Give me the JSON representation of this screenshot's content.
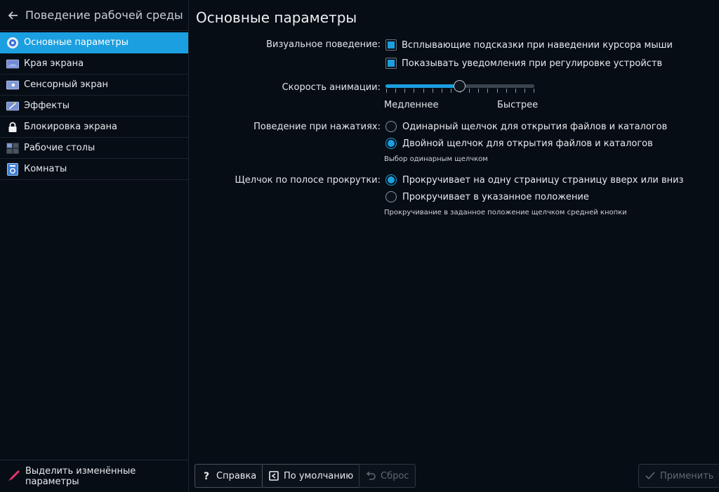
{
  "sidebar": {
    "title": "Поведение рабочей среды",
    "items": [
      {
        "label": "Основные параметры",
        "icon": "general-settings-icon",
        "active": true
      },
      {
        "label": "Края экрана",
        "icon": "screen-edges-icon"
      },
      {
        "label": "Сенсорный экран",
        "icon": "touchscreen-icon"
      },
      {
        "label": "Эффекты",
        "icon": "effects-icon"
      },
      {
        "label": "Блокировка экрана",
        "icon": "lock-icon"
      },
      {
        "label": "Рабочие столы",
        "icon": "virtual-desktops-icon"
      },
      {
        "label": "Комнаты",
        "icon": "activities-icon"
      }
    ],
    "footer_label": "Выделить изменённые параметры"
  },
  "main": {
    "title": "Основные параметры",
    "visual": {
      "label": "Визуальное поведение:",
      "options": [
        {
          "label": "Всплывающие подсказки при наведении курсора мыши",
          "checked": true
        },
        {
          "label": "Показывать уведомления при регулировке устройств",
          "checked": true
        }
      ]
    },
    "animation": {
      "label": "Скорость анимации:",
      "min_label": "Медленнее",
      "max_label": "Быстрее",
      "value": 0.5,
      "ticks": 17
    },
    "click": {
      "label": "Поведение при нажатиях:",
      "options": [
        {
          "label": "Одинарный щелчок для открытия файлов и каталогов",
          "selected": false
        },
        {
          "label": "Двойной щелчок для открытия файлов и каталогов",
          "selected": true
        }
      ],
      "note": "Выбор одинарным щелчком"
    },
    "scrollbar": {
      "label": "Щелчок по полосе прокрутки:",
      "options": [
        {
          "label": "Прокручивает на одну страницу страницу вверх или вниз",
          "selected": true
        },
        {
          "label": "Прокручивает в указанное положение",
          "selected": false
        }
      ],
      "note": "Прокручивание в заданное положение щелчком средней кнопки"
    }
  },
  "buttons": {
    "help": "Справка",
    "defaults": "По умолчанию",
    "reset": "Сброс",
    "apply": "Применить"
  },
  "colors": {
    "accent": "#1c9fe0",
    "background": "#070d15"
  }
}
